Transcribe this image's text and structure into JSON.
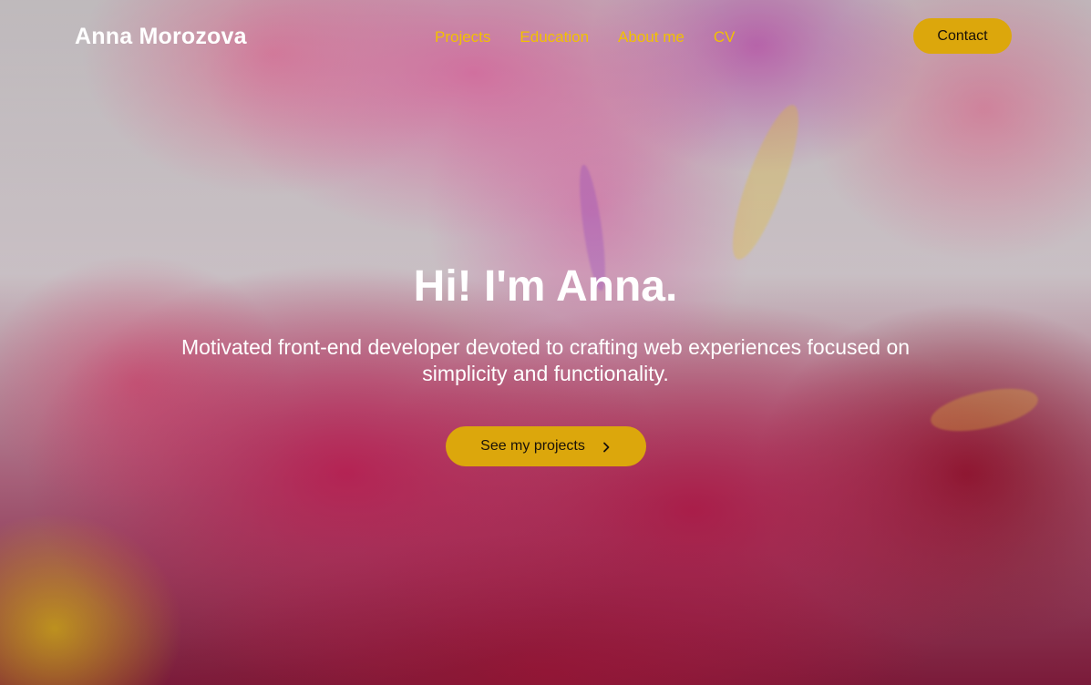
{
  "brand": {
    "name": "Anna Morozova"
  },
  "nav": {
    "links": [
      {
        "label": "Projects"
      },
      {
        "label": "Education"
      },
      {
        "label": "About me"
      },
      {
        "label": "CV"
      }
    ],
    "contact_label": "Contact"
  },
  "hero": {
    "title": "Hi! I'm Anna.",
    "subtitle": "Motivated front-end developer devoted to crafting web experiences focused on simplicity and functionality.",
    "cta_label": "See my projects",
    "cta_icon": "chevron-right-icon"
  },
  "colors": {
    "accent": "#dca70c",
    "nav_link": "#f2c100",
    "text_light": "#ffffff",
    "button_text": "#1a1209"
  }
}
